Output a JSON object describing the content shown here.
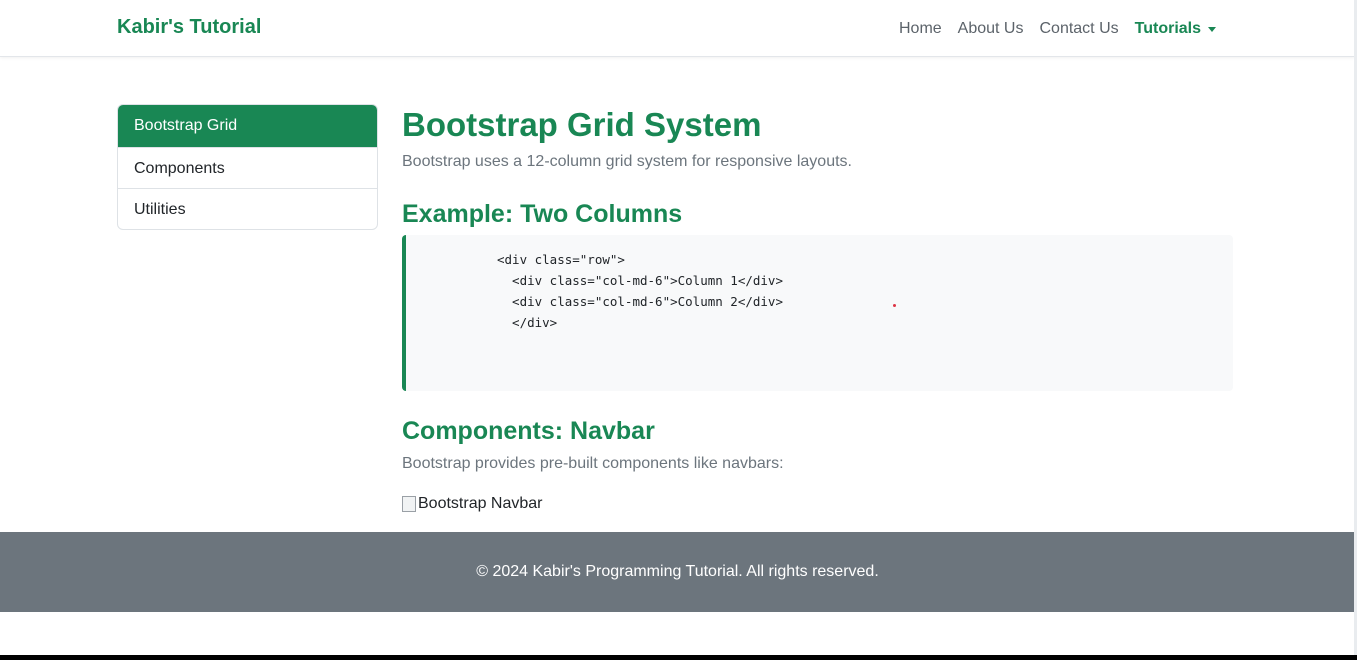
{
  "navbar": {
    "brand": "Kabir's Tutorial",
    "links": [
      {
        "label": "Home"
      },
      {
        "label": "About Us"
      },
      {
        "label": "Contact Us"
      },
      {
        "label": "Tutorials"
      }
    ]
  },
  "sidebar": {
    "items": [
      {
        "label": "Bootstrap Grid",
        "active": true
      },
      {
        "label": "Components",
        "active": false
      },
      {
        "label": "Utilities",
        "active": false
      }
    ]
  },
  "main": {
    "title": "Bootstrap Grid System",
    "intro": "Bootstrap uses a 12-column grid system for responsive layouts.",
    "example_title": "Example: Two Columns",
    "code": "<div class=\"row\">\n  <div class=\"col-md-6\">Column 1</div>\n  <div class=\"col-md-6\">Column 2</div>\n  </div>",
    "components_title": "Components: Navbar",
    "components_text": "Bootstrap provides pre-built components like navbars:",
    "image_alt": "Bootstrap Navbar"
  },
  "footer": {
    "text": "© 2024 Kabir's Programming Tutorial. All rights reserved."
  },
  "colors": {
    "accent": "#198754",
    "footer_bg": "#6c757d",
    "muted_text": "#6c757d"
  },
  "icons": {
    "dropdown": "caret-down-icon",
    "broken_image": "broken-image-icon"
  }
}
